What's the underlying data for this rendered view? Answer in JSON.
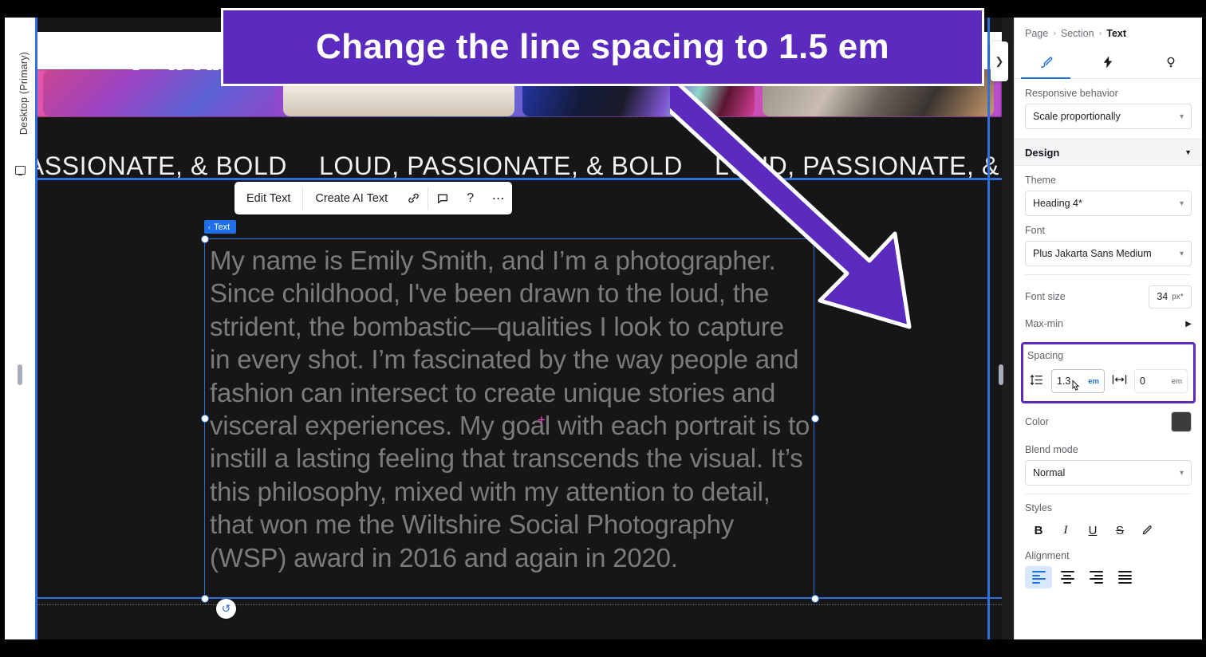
{
  "banner": {
    "instruction": "Change the line spacing to 1.5 em"
  },
  "viewport": {
    "label": "Desktop (Primary)",
    "icon": "monitor-icon"
  },
  "canvas": {
    "hero_word": "CAIN",
    "marquee_text": "LOUD, PASSIONATE, & BOLD",
    "marquee_separator": "star-icon",
    "selection_tag": "Text",
    "selection_tag_chevron": "‹",
    "body_text": "My name is Emily Smith, and I’m a photographer. Since childhood, I've been drawn to the loud, the strident, the bombastic—qualities I look to capture in every shot. I’m fascinated by the way people and fashion can intersect to create unique stories and visceral experiences. My goal with each portrait is to instill a lasting feeling that transcends the visual. It’s this philosophy, mixed with my attention to detail, that won me the Wiltshire Social Photography (WSP) award in 2016 and again in 2020.",
    "rotate_handle_icon": "↺",
    "add_cursor_icon": "+",
    "collapse_icon": "❯"
  },
  "toolbar": {
    "edit_text": "Edit Text",
    "create_ai_text": "Create AI Text",
    "link_icon": "🔗",
    "comment_icon": "⬜",
    "help_label": "?",
    "more_label": "⋯"
  },
  "panel": {
    "breadcrumb": {
      "page": "Page",
      "section": "Section",
      "current": "Text",
      "separator": "›"
    },
    "tabs": [
      {
        "name": "design-tab",
        "icon": "brush-icon",
        "glyph": "✎",
        "active": true
      },
      {
        "name": "interactions-tab",
        "icon": "lightning-icon",
        "glyph": "⚡",
        "active": false
      },
      {
        "name": "insights-tab",
        "icon": "lightbulb-icon",
        "glyph": "○",
        "active": false
      }
    ],
    "responsive": {
      "label": "Responsive behavior",
      "value": "Scale proportionally"
    },
    "design_section": {
      "title": "Design",
      "collapse_icon": "▼"
    },
    "theme": {
      "label": "Theme",
      "value": "Heading 4*"
    },
    "font": {
      "label": "Font",
      "value": "Plus Jakarta Sans Medium"
    },
    "font_size": {
      "label": "Font size",
      "value": "34",
      "unit": "px*"
    },
    "max_min": {
      "label": "Max-min",
      "arrow": "▶"
    },
    "spacing": {
      "label": "Spacing",
      "line_spacing": {
        "icon": "line-spacing-icon",
        "value": "1.3",
        "unit": "em"
      },
      "letter_spacing": {
        "icon": "letter-spacing-icon",
        "value": "0",
        "unit": "em"
      },
      "highlight_color": "#5b2bbf"
    },
    "color": {
      "label": "Color",
      "value": "#3c3c3c"
    },
    "blend_mode": {
      "label": "Blend mode",
      "value": "Normal"
    },
    "styles": {
      "label": "Styles",
      "buttons": [
        {
          "name": "bold-button",
          "glyph": "B"
        },
        {
          "name": "italic-button",
          "glyph": "I"
        },
        {
          "name": "underline-button",
          "glyph": "U"
        },
        {
          "name": "strikethrough-button",
          "glyph": "S"
        },
        {
          "name": "edit-style-button",
          "glyph": "✎"
        }
      ]
    },
    "alignment": {
      "label": "Alignment",
      "options": [
        "align-left",
        "align-center",
        "align-right",
        "align-justify"
      ],
      "selected": "align-left"
    }
  },
  "colors": {
    "accent_purple": "#5b2bbf",
    "selection_blue": "#2f6fe0",
    "tab_blue": "#1a73e8"
  }
}
